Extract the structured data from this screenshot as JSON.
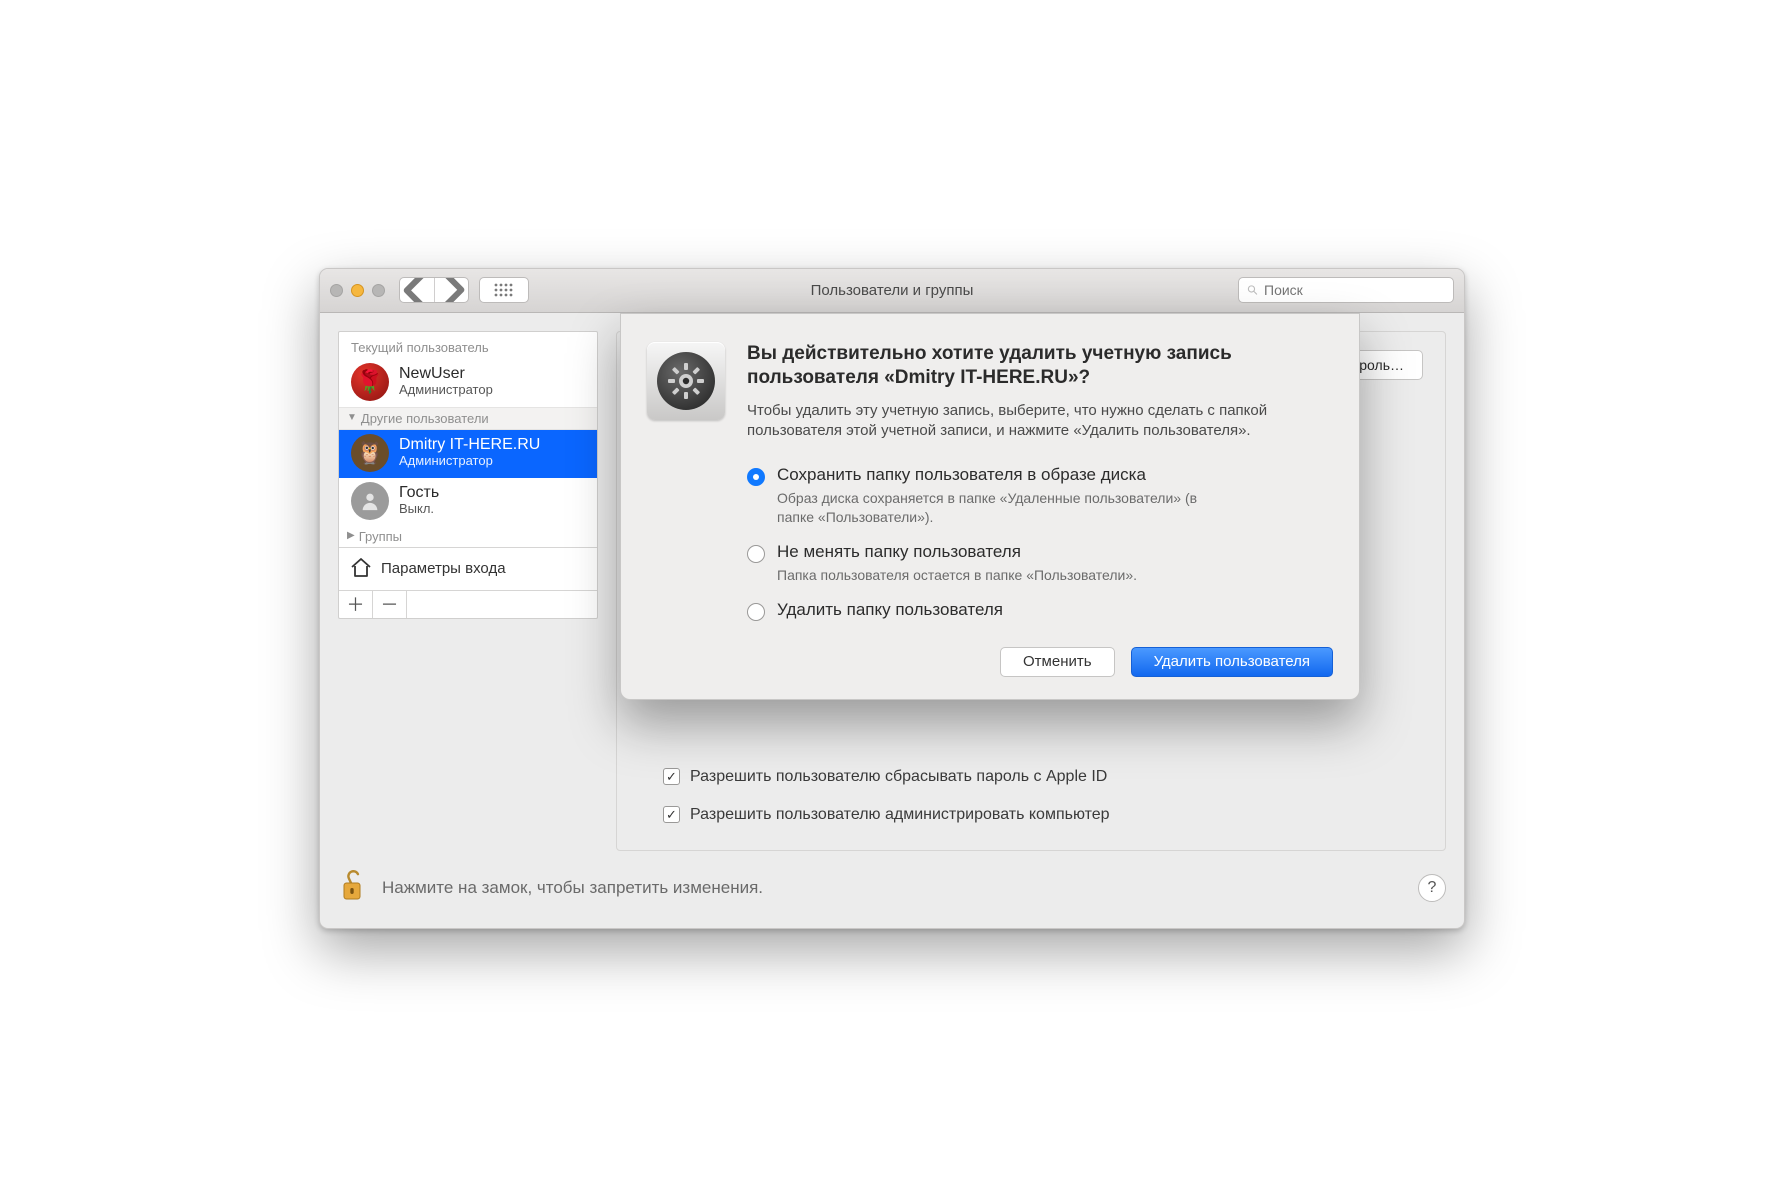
{
  "titlebar": {
    "window_title": "Пользователи и группы",
    "search_placeholder": "Поиск"
  },
  "sidebar": {
    "current_header": "Текущий пользователь",
    "other_header": "Другие пользователи",
    "groups_header": "Группы",
    "users": {
      "current": {
        "name": "NewUser",
        "role": "Администратор"
      },
      "selected": {
        "name": "Dmitry IT-HERE.RU",
        "role": "Администратор"
      },
      "guest": {
        "name": "Гость",
        "role": "Выкл."
      }
    },
    "login_options": "Параметры входа"
  },
  "main": {
    "reset_password_btn": "сить пароль…",
    "check1": "Разрешить пользователю сбрасывать пароль с Apple ID",
    "check2": "Разрешить пользователю администрировать компьютер"
  },
  "lock": {
    "text": "Нажмите на замок, чтобы запретить изменения."
  },
  "dialog": {
    "title": "Вы действительно хотите удалить учетную запись пользователя «Dmitry IT-HERE.RU»?",
    "desc": "Чтобы удалить эту учетную запись, выберите, что нужно сделать с папкой пользователя этой учетной записи, и нажмите «Удалить пользователя».",
    "opt1_label": "Сохранить папку пользователя в образе диска",
    "opt1_desc": "Образ диска сохраняется в папке «Удаленные пользователи» (в папке «Пользователи»).",
    "opt2_label": "Не менять папку пользователя",
    "opt2_desc": "Папка пользователя остается в папке «Пользователи».",
    "opt3_label": "Удалить папку пользователя",
    "cancel": "Отменить",
    "confirm": "Удалить пользователя"
  }
}
